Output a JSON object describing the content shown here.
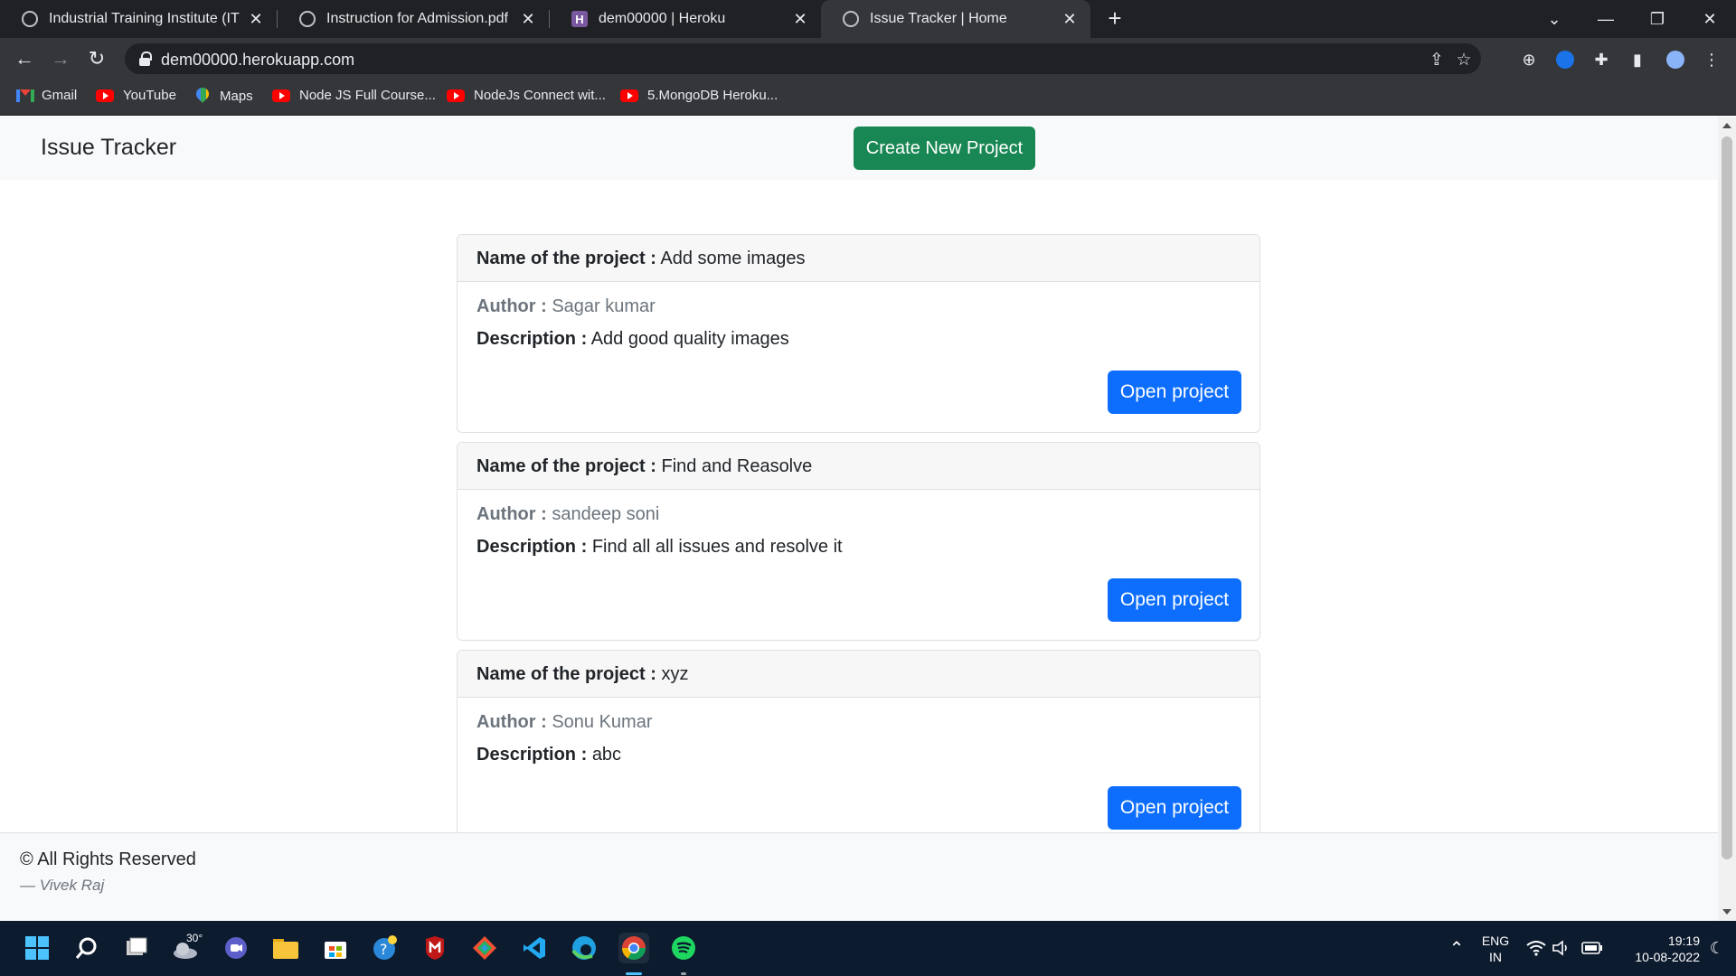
{
  "browser": {
    "tabs": [
      {
        "title": "Industrial Training Institute (ITI), ",
        "icon": "globe-icon",
        "active": false
      },
      {
        "title": "Instruction for Admission.pdf",
        "icon": "globe-icon",
        "active": false
      },
      {
        "title": "dem00000 | Heroku",
        "icon": "heroku-icon",
        "heroku_letter": "H",
        "active": false
      },
      {
        "title": "Issue Tracker | Home",
        "icon": "globe-icon",
        "active": true
      }
    ],
    "new_tab": "+",
    "url": "dem00000.herokuapp.com",
    "bookmarks": [
      {
        "label": "Gmail",
        "icon": "gmail-icon"
      },
      {
        "label": "YouTube",
        "icon": "youtube-icon"
      },
      {
        "label": "Maps",
        "icon": "maps-icon"
      },
      {
        "label": "Node JS Full Course...",
        "icon": "youtube-icon"
      },
      {
        "label": "NodeJs Connect wit...",
        "icon": "youtube-icon"
      },
      {
        "label": "5.MongoDB Heroku...",
        "icon": "youtube-icon"
      }
    ]
  },
  "app": {
    "brand": "Issue Tracker",
    "create_button": "Create New Project",
    "labels": {
      "name": "Name of the project :",
      "author": "Author :",
      "description": "Description :",
      "open": "Open project"
    },
    "projects": [
      {
        "name": "Add some images",
        "author": "Sagar kumar",
        "description": "Add good quality images"
      },
      {
        "name": "Find and Reasolve",
        "author": "sandeep soni",
        "description": "Find all all issues and resolve it"
      },
      {
        "name": "xyz",
        "author": "Sonu Kumar",
        "description": "abc"
      }
    ],
    "footer": {
      "copyright": "© All Rights Reserved",
      "cite": "— Vivek Raj"
    },
    "colors": {
      "create_button": "#198754",
      "open_button": "#0d6efd",
      "navbar": "#f8f9fa"
    }
  },
  "taskbar": {
    "weather": "30°",
    "lang_line1": "ENG",
    "lang_line2": "IN",
    "time": "19:19",
    "date": "10-08-2022"
  }
}
